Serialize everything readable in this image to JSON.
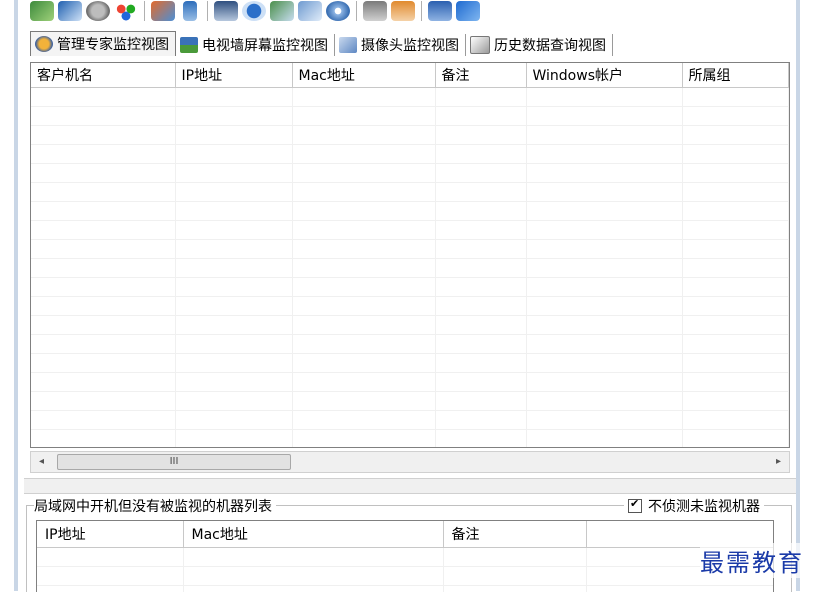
{
  "toolbar": {
    "icons": [
      "edit-icon",
      "window-icon",
      "gear-icon",
      "flower-icon",
      "users-icon",
      "usb-icon",
      "monitor-icon",
      "network-icon",
      "magnifier-icon",
      "copy-icon",
      "disc-icon",
      "server-icon",
      "person-icon",
      "cart-icon",
      "exit-icon"
    ]
  },
  "tabs": [
    {
      "label": "管理专家监控视图",
      "active": true
    },
    {
      "label": "电视墙屏幕监控视图",
      "active": false
    },
    {
      "label": "摄像头监控视图",
      "active": false
    },
    {
      "label": "历史数据查询视图",
      "active": false
    }
  ],
  "main_table": {
    "columns": [
      "客户机名",
      "IP地址",
      "Mac地址",
      "备注",
      "Windows帐户",
      "所属组"
    ]
  },
  "scrollbar": {
    "thumb_label": "III",
    "left_arrow": "◂",
    "right_arrow": "▸"
  },
  "lower_panel": {
    "title": "局域网中开机但没有被监视的机器列表",
    "checkbox_label": "不侦测未监视机器",
    "checkbox_checked": true,
    "columns": [
      "IP地址",
      "Mac地址",
      "备注",
      ""
    ]
  },
  "watermark": "最需教育"
}
